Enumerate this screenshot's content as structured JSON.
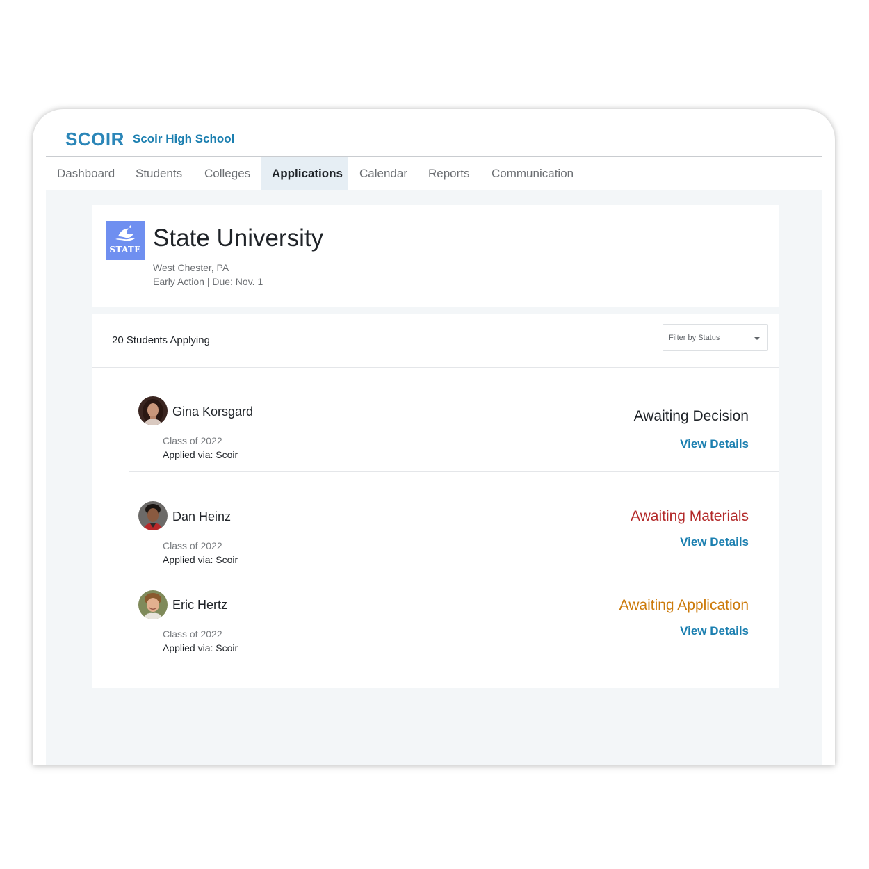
{
  "brand": {
    "logo_text": "SCOIR",
    "school_name": "Scoir High School",
    "color": "#1b7fb0"
  },
  "nav": [
    {
      "label": "Dashboard",
      "active": false
    },
    {
      "label": "Students",
      "active": false
    },
    {
      "label": "Colleges",
      "active": false
    },
    {
      "label": "Applications",
      "active": true
    },
    {
      "label": "Calendar",
      "active": false
    },
    {
      "label": "Reports",
      "active": false
    },
    {
      "label": "Communication",
      "active": false
    }
  ],
  "university": {
    "logo_label": "STATE",
    "name": "State University",
    "location": "West Chester, PA",
    "deadline": "Early Action | Due: Nov. 1"
  },
  "applicants": {
    "count_label": "20 Students Applying",
    "filter_placeholder": "Filter by Status",
    "students": [
      {
        "name": "Gina Korsgard",
        "class": "Class of 2022",
        "applied_via": "Applied via: Scoir",
        "status": "Awaiting Decision",
        "status_color": "#1f2328",
        "action": "View Details"
      },
      {
        "name": "Dan Heinz",
        "class": "Class of 2022",
        "applied_via": "Applied via: Scoir",
        "status": "Awaiting Materials",
        "status_color": "#b32a2a",
        "action": "View Details"
      },
      {
        "name": "Eric Hertz",
        "class": "Class of 2022",
        "applied_via": "Applied via: Scoir",
        "status": "Awaiting Application",
        "status_color": "#cc7a0a",
        "action": "View Details"
      }
    ]
  }
}
